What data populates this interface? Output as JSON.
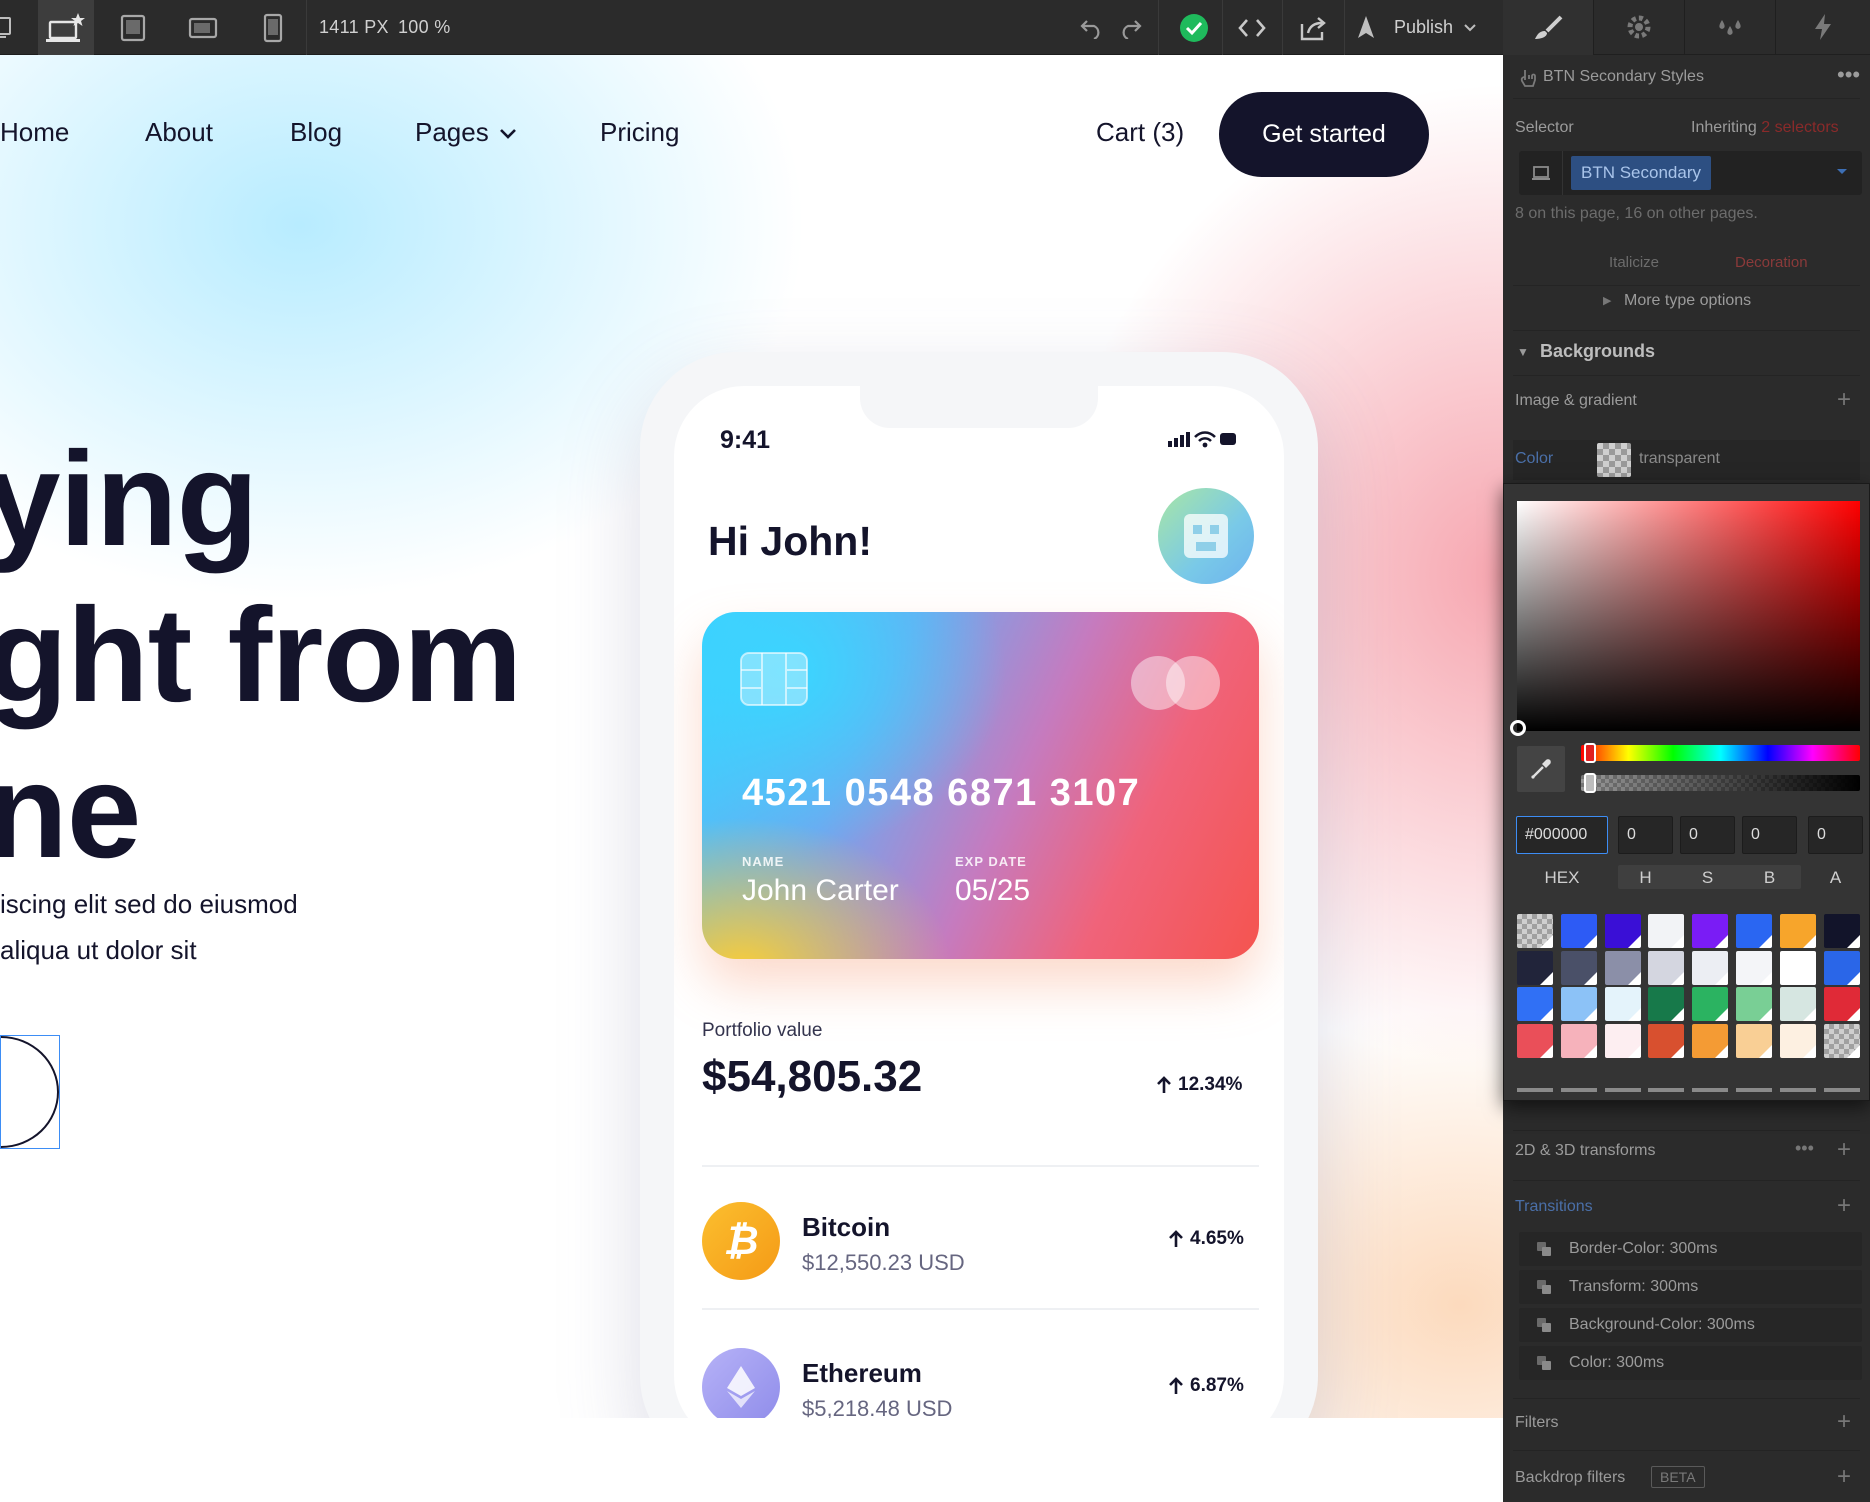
{
  "toolbar": {
    "viewport_width": "1411 PX",
    "zoom": "100 %",
    "publish_label": "Publish"
  },
  "site": {
    "nav": [
      "Home",
      "About",
      "Blog",
      "Pages",
      "Pricing"
    ],
    "cart": "Cart (3)",
    "cta": "Get started",
    "hero_lines": [
      "ying",
      "ght from",
      "ne"
    ],
    "hero_sub_lines": [
      "iscing elit sed do eiusmod",
      "aliqua ut dolor sit"
    ]
  },
  "phone": {
    "time": "9:41",
    "greeting": "Hi John!",
    "card": {
      "number": "4521 0548 6871 3107",
      "name_caption": "NAME",
      "name": "John Carter",
      "exp_caption": "EXP DATE",
      "exp": "05/25"
    },
    "portfolio_label": "Portfolio value",
    "portfolio_value": "$54,805.32",
    "portfolio_change": "12.34%",
    "coins": [
      {
        "name": "Bitcoin",
        "price": "$12,550.23 USD",
        "change": "4.65%",
        "color": "#f7a11a"
      },
      {
        "name": "Ethereum",
        "price": "$5,218.48 USD",
        "change": "6.87%",
        "color": "#a3a0f2"
      }
    ]
  },
  "panel": {
    "title": "BTN Secondary Styles",
    "selector_label": "Selector",
    "inheriting_prefix": "Inheriting",
    "inheriting_count": "2 selectors",
    "selector_value": "BTN Secondary",
    "usage_note": "8 on this page, 16 on other pages.",
    "italicize": "Italicize",
    "decoration": "Decoration",
    "more_type": "More type options",
    "backgrounds": "Backgrounds",
    "image_gradient": "Image & gradient",
    "color_label": "Color",
    "color_value": "transparent",
    "transforms": "2D & 3D transforms",
    "transitions": "Transitions",
    "transition_items": [
      "Border-Color: 300ms",
      "Transform: 300ms",
      "Background-Color: 300ms",
      "Color: 300ms"
    ],
    "filters": "Filters",
    "backdrop": "Backdrop filters",
    "beta": "BETA"
  },
  "picker": {
    "hex": "#000000",
    "h": "0",
    "s": "0",
    "b": "0",
    "a": "0",
    "labels": [
      "HEX",
      "H",
      "S",
      "B",
      "A"
    ],
    "swatches": [
      "check",
      "#2d5bf5",
      "#3a0fd6",
      "#f2f3f6",
      "#7a1cf5",
      "#2a66f2",
      "#f7a52b",
      "#12142a",
      "#21243a",
      "#4a5068",
      "#8b8fa8",
      "#d4d6e0",
      "#eceef3",
      "#f4f5f8",
      "#ffffff",
      "#2a66e8",
      "#3070f5",
      "#8cc2f7",
      "#e4f3fb",
      "#17794a",
      "#2bb361",
      "#79cf95",
      "#d6e6e1",
      "#e02a37",
      "#ea4f59",
      "#f6b2bb",
      "#fdeef1",
      "#d8502f",
      "#f49b34",
      "#f9cf95",
      "#fdf0e1",
      "check"
    ]
  }
}
